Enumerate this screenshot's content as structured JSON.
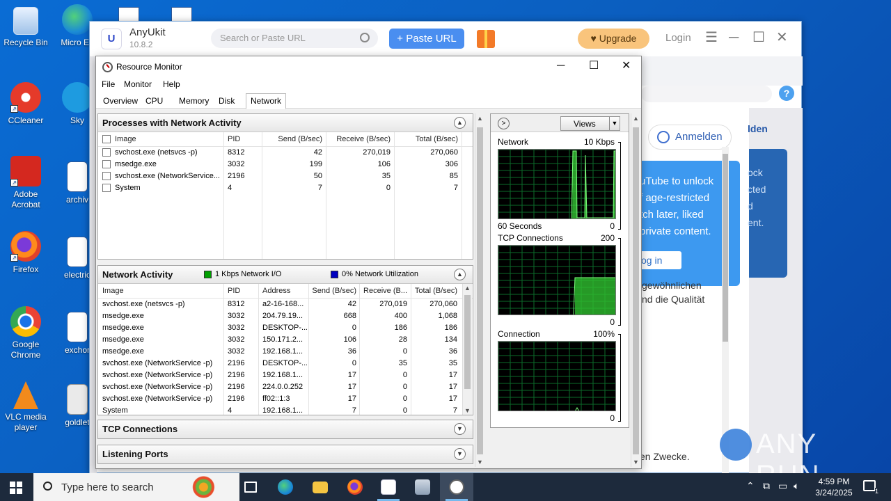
{
  "desktop": {
    "icons": [
      {
        "label": "Recycle Bin"
      },
      {
        "label": "Micro Ed"
      },
      {
        "label": "CCleaner"
      },
      {
        "label": "Sky"
      },
      {
        "label": "Adobe Acrobat"
      },
      {
        "label": "archiv"
      },
      {
        "label": "Firefox"
      },
      {
        "label": "electric"
      },
      {
        "label": "Google Chrome"
      },
      {
        "label": "exchor"
      },
      {
        "label": "VLC media player"
      },
      {
        "label": "goldlet"
      }
    ]
  },
  "anyukit": {
    "logo": "U",
    "name": "AnyUkit",
    "version": "10.8.2",
    "search_placeholder": "Search or Paste URL",
    "paste_url": "+ Paste URL",
    "upgrade": "♥ Upgrade",
    "login": "Login",
    "help": "?",
    "anmelden": "Anmelden",
    "den": "lden",
    "blue_lines": [
      "ock",
      "cted",
      "d",
      "ent."
    ],
    "popup_lines": [
      "uTube to unlock",
      "f age-restricted",
      "tch later, liked",
      "private content."
    ],
    "popup_button": "og in",
    "de_text_1": "gewöhnlichen",
    "de_text_2": "nd die Qualität",
    "de_text_3": "en Zwecke."
  },
  "resmon": {
    "title": "Resource Monitor",
    "menu": [
      "File",
      "Monitor",
      "Help"
    ],
    "tabs": [
      "Overview",
      "CPU",
      "Memory",
      "Disk",
      "Network"
    ],
    "active_tab": "Network",
    "processes": {
      "title": "Processes with Network Activity",
      "columns": [
        "Image",
        "PID",
        "Send (B/sec)",
        "Receive (B/sec)",
        "Total (B/sec)"
      ],
      "rows": [
        {
          "image": "svchost.exe (netsvcs -p)",
          "pid": "8312",
          "send": "42",
          "receive": "270,019",
          "total": "270,060"
        },
        {
          "image": "msedge.exe",
          "pid": "3032",
          "send": "199",
          "receive": "106",
          "total": "306"
        },
        {
          "image": "svchost.exe (NetworkService...",
          "pid": "2196",
          "send": "50",
          "receive": "35",
          "total": "85"
        },
        {
          "image": "System",
          "pid": "4",
          "send": "7",
          "receive": "0",
          "total": "7"
        }
      ]
    },
    "network_activity": {
      "title": "Network Activity",
      "legend_io": "1 Kbps Network I/O",
      "legend_util": "0% Network Utilization",
      "legend_io_color": "#00a000",
      "legend_util_color": "#0000c0",
      "columns": [
        "Image",
        "PID",
        "Address",
        "Send (B/sec)",
        "Receive (B...",
        "Total (B/sec)"
      ],
      "rows": [
        {
          "image": "svchost.exe (netsvcs -p)",
          "pid": "8312",
          "address": "a2-16-168...",
          "send": "42",
          "receive": "270,019",
          "total": "270,060"
        },
        {
          "image": "msedge.exe",
          "pid": "3032",
          "address": "204.79.19...",
          "send": "668",
          "receive": "400",
          "total": "1,068"
        },
        {
          "image": "msedge.exe",
          "pid": "3032",
          "address": "DESKTOP-...",
          "send": "0",
          "receive": "186",
          "total": "186"
        },
        {
          "image": "msedge.exe",
          "pid": "3032",
          "address": "150.171.2...",
          "send": "106",
          "receive": "28",
          "total": "134"
        },
        {
          "image": "msedge.exe",
          "pid": "3032",
          "address": "192.168.1...",
          "send": "36",
          "receive": "0",
          "total": "36"
        },
        {
          "image": "svchost.exe (NetworkService -p)",
          "pid": "2196",
          "address": "DESKTOP-...",
          "send": "0",
          "receive": "35",
          "total": "35"
        },
        {
          "image": "svchost.exe (NetworkService -p)",
          "pid": "2196",
          "address": "192.168.1...",
          "send": "17",
          "receive": "0",
          "total": "17"
        },
        {
          "image": "svchost.exe (NetworkService -p)",
          "pid": "2196",
          "address": "224.0.0.252",
          "send": "17",
          "receive": "0",
          "total": "17"
        },
        {
          "image": "svchost.exe (NetworkService -p)",
          "pid": "2196",
          "address": "ff02::1:3",
          "send": "17",
          "receive": "0",
          "total": "17"
        },
        {
          "image": "System",
          "pid": "4",
          "address": "192.168.1...",
          "send": "7",
          "receive": "0",
          "total": "7"
        }
      ]
    },
    "tcp_title": "TCP Connections",
    "listening_title": "Listening Ports",
    "views_label": "Views",
    "graphs": {
      "network": {
        "label": "Network",
        "max": "10 Kbps",
        "foot_left": "60 Seconds",
        "foot_right": "0"
      },
      "tcp": {
        "label": "TCP Connections",
        "max": "200",
        "foot_right": "0"
      },
      "connection": {
        "label": "Connection",
        "max": "100%",
        "foot_right": "0"
      }
    }
  },
  "taskbar": {
    "search_placeholder": "Type here to search",
    "time": "4:59 PM",
    "date": "3/24/2025",
    "notif_count": "1"
  },
  "watermark": "ANY RUN"
}
